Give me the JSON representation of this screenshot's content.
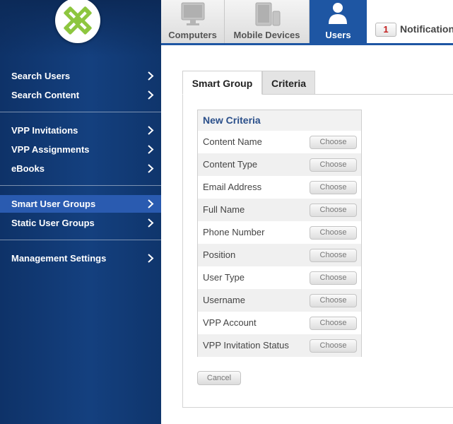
{
  "sidebar": {
    "items": [
      {
        "label": "Search Users"
      },
      {
        "label": "Search Content"
      },
      {
        "label": "VPP Invitations"
      },
      {
        "label": "VPP Assignments"
      },
      {
        "label": "eBooks"
      },
      {
        "label": "Smart User Groups",
        "active": true
      },
      {
        "label": "Static User Groups"
      },
      {
        "label": "Management Settings"
      }
    ]
  },
  "top_tabs": [
    {
      "label": "Computers",
      "icon": "computer-icon"
    },
    {
      "label": "Mobile Devices",
      "icon": "mobile-device-icon"
    },
    {
      "label": "Users",
      "icon": "user-icon",
      "active": true
    }
  ],
  "notifications": {
    "count": "1",
    "label": "Notifications"
  },
  "subtabs": [
    {
      "label": "Smart Group",
      "active": true
    },
    {
      "label": "Criteria"
    }
  ],
  "criteria": {
    "title": "New Criteria",
    "button_label": "Choose",
    "rows": [
      {
        "name": "Content Name"
      },
      {
        "name": "Content Type"
      },
      {
        "name": "Email Address"
      },
      {
        "name": "Full Name"
      },
      {
        "name": "Phone Number"
      },
      {
        "name": "Position"
      },
      {
        "name": "User Type"
      },
      {
        "name": "Username"
      },
      {
        "name": "VPP Account"
      },
      {
        "name": "VPP Invitation Status"
      }
    ]
  },
  "cancel_label": "Cancel",
  "colors": {
    "sidebar_bg": "#14407f",
    "active_nav": "#2a5bb0",
    "active_tab": "#1e56a3",
    "logo_green": "#8dc63f",
    "criteria_title": "#2a4f8a",
    "notif_count": "#c31f1f"
  }
}
